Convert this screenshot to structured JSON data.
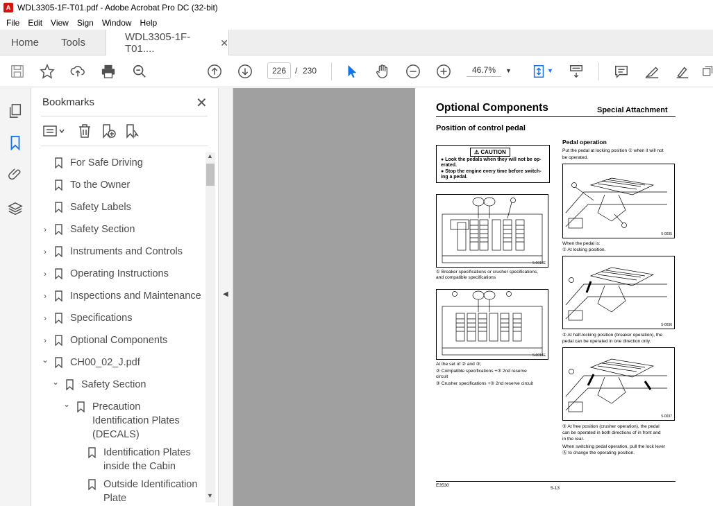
{
  "window": {
    "title": "WDL3305-1F-T01.pdf - Adobe Acrobat Pro DC (32-bit)"
  },
  "menu": [
    "File",
    "Edit",
    "View",
    "Sign",
    "Window",
    "Help"
  ],
  "tabs": {
    "home": "Home",
    "tools": "Tools",
    "document": "WDL3305-1F-T01....",
    "close": "✕"
  },
  "toolbar": {
    "page_current": "226",
    "page_sep": "/",
    "page_total": "230",
    "zoom": "46.7%",
    "icons": [
      "save-icon",
      "star-icon",
      "upload-icon",
      "print-icon",
      "search-icon",
      "prev-page-icon",
      "next-page-icon",
      "select-cursor-icon",
      "hand-icon",
      "zoom-out-icon",
      "zoom-in-icon",
      "fit-page-icon",
      "scroll-mode-icon",
      "comment-icon",
      "highlight-icon",
      "sign-icon",
      "more-icon"
    ]
  },
  "rail": {
    "icons": [
      "pages-icon",
      "bookmark-icon",
      "attachment-icon",
      "layers-icon"
    ]
  },
  "bookmarks": {
    "title": "Bookmarks",
    "close": "✕",
    "items": [
      {
        "label": "For Safe Driving",
        "chevron": ""
      },
      {
        "label": "To the Owner",
        "chevron": ""
      },
      {
        "label": "Safety Labels",
        "chevron": ""
      },
      {
        "label": "Safety Section",
        "chevron": "›"
      },
      {
        "label": "Instruments and Controls",
        "chevron": "›"
      },
      {
        "label": "Operating Instructions",
        "chevron": "›"
      },
      {
        "label": "Inspections and Maintenance",
        "chevron": "›"
      },
      {
        "label": "Specifications",
        "chevron": "›"
      },
      {
        "label": "Optional Components",
        "chevron": "›"
      },
      {
        "label": "CH00_02_J.pdf",
        "chevron": "⌄"
      },
      {
        "label": "Safety Section",
        "chevron": "⌄"
      },
      {
        "label_lines": [
          "Precaution",
          "Identification Plates",
          "(DECALS)"
        ],
        "chevron": "⌄"
      },
      {
        "label_lines": [
          "Identification Plates",
          "inside the Cabin"
        ],
        "chevron": ""
      },
      {
        "label_lines": [
          "Outside Identification",
          "Plate"
        ],
        "chevron": ""
      }
    ]
  },
  "document": {
    "heading": "Optional Components",
    "heading_right": "Special Attachment",
    "subheading": "Position of control pedal",
    "caution": {
      "title": "⚠ CAUTION",
      "lines": [
        "● Look the pedals when they will not be op-",
        "   erated.",
        "● Stop the engine every time before switch-",
        "   ing a pedal."
      ]
    },
    "fig1_id": "5-0013E",
    "fig1_caption": [
      "① Breaker specifications or crusher specifications,",
      "and compatible specifications"
    ],
    "fig2_id": "5-0014E",
    "fig2_caption": [
      "At the set of ② and ③;",
      "② Compatible specifications +③ 2nd reserve",
      "    circuit",
      "③ Crusher specifications +③ 2nd reserve circuit"
    ],
    "pedal_heading": "Pedal operation",
    "pedal_text": [
      "Put the pedal at locking position ① when it will not",
      "be operated."
    ],
    "fig3_id": "5-0035",
    "fig3_caption": [
      "When the pedal is:",
      "① At locking position."
    ],
    "fig4_id": "5-0036",
    "fig4_caption": [
      "② At half-locking position (breaker operation), the",
      "    pedal can be operated in one direction only."
    ],
    "fig5_id": "5-0037",
    "fig5_caption": [
      "③ At free position (crusher operation), the pedal",
      "    can be operated in both directions of in front and",
      "    in the rear.",
      "When switching pedal operation, pull the lock lever",
      "Ⓐ to change the operating position."
    ],
    "footer_left": "E3530",
    "footer_center": "5-13"
  }
}
